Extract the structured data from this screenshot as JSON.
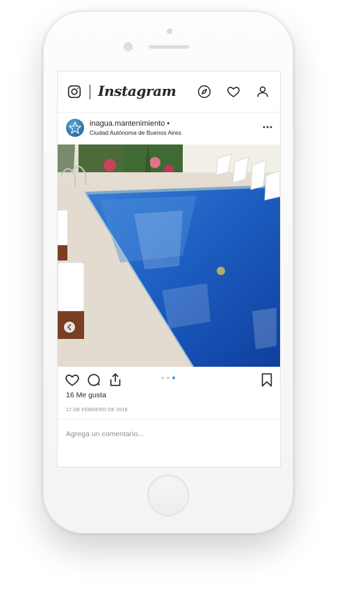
{
  "app": {
    "wordmark": "Instagram"
  },
  "post": {
    "username": "inagua.mantenimiento •",
    "location": "Ciudad Autónoma de Buenos Aires",
    "likes_text": "16 Me gusta",
    "date": "12 DE FEBRERO DE 2018",
    "carousel": {
      "total": 3,
      "active": 3
    }
  },
  "comment": {
    "placeholder": "Agrega un comentario..."
  },
  "icons": {
    "camera": "camera-icon",
    "explore": "compass-icon",
    "activity": "heart-icon",
    "profile": "user-icon",
    "more": "more-icon",
    "like": "heart-outline-icon",
    "comment": "comment-icon",
    "share": "share-icon",
    "save": "bookmark-icon",
    "previous": "chevron-left-icon"
  },
  "colors": {
    "text": "#262626",
    "muted": "#8e8e8e",
    "accent": "#3897f0",
    "pool": "#1a5fc0"
  }
}
